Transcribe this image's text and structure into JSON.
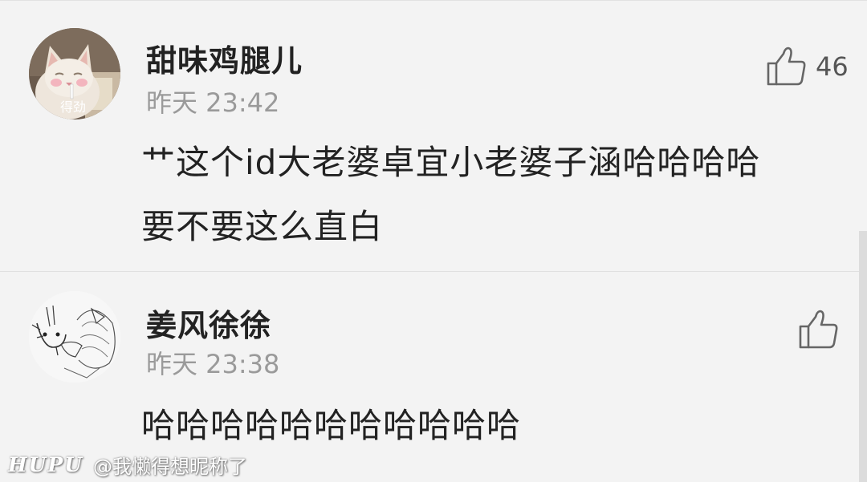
{
  "comments": [
    {
      "username": "甜味鸡腿儿",
      "time": "昨天 23:42",
      "text_lines": [
        "艹这个id大老婆卓宜小老婆子涵哈哈哈哈",
        "要不要这么直白"
      ],
      "like_count": "46",
      "avatar_caption": "得劲"
    },
    {
      "username": "姜风徐徐",
      "time": "昨天 23:38",
      "text_lines": [
        "哈哈哈哈哈哈哈哈哈哈哈"
      ],
      "like_count": ""
    }
  ],
  "watermark": {
    "logo": "HUPU",
    "user": "@我懒得想昵称了"
  },
  "icons": {
    "like": "thumbs-up-icon"
  },
  "colors": {
    "background": "#f3f3f3",
    "username": "#222222",
    "time": "#9a9a9a"
  }
}
